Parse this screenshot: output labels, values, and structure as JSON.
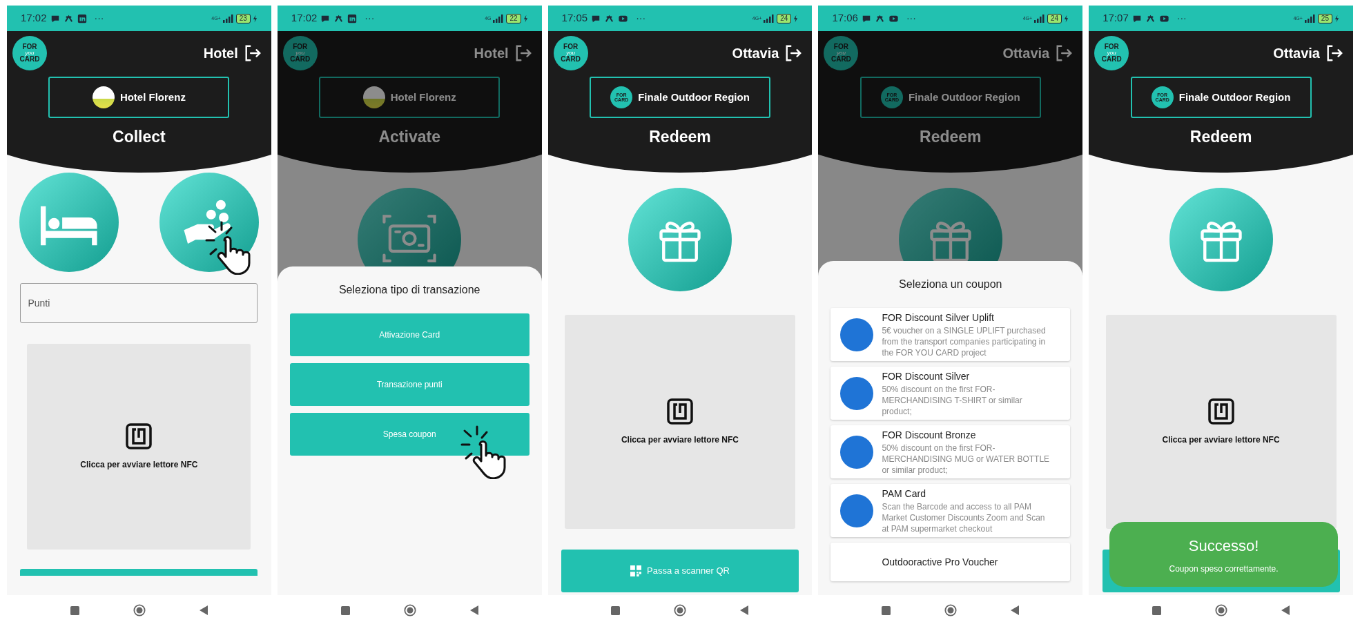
{
  "screens": [
    {
      "status": {
        "time": "17:02",
        "app_icons": [
          {
            "kind": "message"
          },
          {
            "kind": "share"
          },
          {
            "kind": "linkedin"
          }
        ],
        "more": "···",
        "network": "4G+",
        "battery": "23"
      },
      "header": {
        "logo": [
          "FOR",
          "you",
          "CARD"
        ],
        "title": "Hotel",
        "venue": {
          "name": "Hotel Florenz",
          "avatar": {
            "kind": "photo"
          }
        }
      },
      "page_title": "Collect",
      "dimmed": false,
      "hero_icons": [
        {
          "kind": "bed",
          "tapped": false
        },
        {
          "kind": "hand-coins",
          "tapped": true
        }
      ],
      "points_field": {
        "placeholder": "Punti"
      },
      "nfc_panel": {
        "label": "Clicca per avviare lettore NFC"
      },
      "bottom_button": {
        "kind": "cut"
      }
    },
    {
      "status": {
        "time": "17:02",
        "app_icons": [
          {
            "kind": "message"
          },
          {
            "kind": "share"
          },
          {
            "kind": "linkedin"
          }
        ],
        "more": "···",
        "network": "4G",
        "battery": "22"
      },
      "header": {
        "logo": [
          "FOR",
          "you",
          "CARD"
        ],
        "title": "Hotel",
        "venue": {
          "name": "Hotel Florenz",
          "avatar": {
            "kind": "photo"
          }
        }
      },
      "page_title": "Activate",
      "dimmed": true,
      "hero_icons": [
        {
          "kind": "cash-scan",
          "tapped": false
        }
      ],
      "sheet": {
        "kind": "buttons",
        "title": "Seleziona tipo di transazione",
        "buttons": [
          {
            "label": "Attivazione Card",
            "tapped": false
          },
          {
            "label": "Transazione punti",
            "tapped": false
          },
          {
            "label": "Spesa coupon",
            "tapped": true
          }
        ]
      }
    },
    {
      "status": {
        "time": "17:05",
        "app_icons": [
          {
            "kind": "message"
          },
          {
            "kind": "share"
          },
          {
            "kind": "video"
          }
        ],
        "more": "···",
        "network": "4G+",
        "battery": "24"
      },
      "header": {
        "logo": [
          "FOR",
          "you",
          "CARD"
        ],
        "title": "Ottavia",
        "venue": {
          "name": "Finale Outdoor Region",
          "avatar": {
            "kind": "brand",
            "texts": [
              "FOR",
              "CARD"
            ]
          }
        }
      },
      "page_title": "Redeem",
      "dimmed": false,
      "hero_icons": [
        {
          "kind": "gift",
          "tapped": false
        }
      ],
      "nfc_panel": {
        "label": "Clicca per avviare lettore NFC"
      },
      "bottom_button": {
        "kind": "full",
        "label": "Passa a scanner QR"
      }
    },
    {
      "status": {
        "time": "17:06",
        "app_icons": [
          {
            "kind": "message"
          },
          {
            "kind": "share"
          },
          {
            "kind": "video"
          }
        ],
        "more": "···",
        "network": "4G+",
        "battery": "24"
      },
      "header": {
        "logo": [
          "FOR",
          "you",
          "CARD"
        ],
        "title": "Ottavia",
        "venue": {
          "name": "Finale Outdoor Region",
          "avatar": {
            "kind": "brand",
            "texts": [
              "FOR",
              "CARD"
            ]
          }
        }
      },
      "page_title": "Redeem",
      "dimmed": true,
      "hero_icons": [
        {
          "kind": "gift",
          "tapped": false
        }
      ],
      "sheet": {
        "kind": "coupons",
        "title": "Seleziona un coupon",
        "coupons": [
          {
            "title": "FOR Discount Silver Uplift",
            "description": "5€ voucher on a SINGLE UPLIFT purchased from the transport companies participating in the FOR YOU CARD project"
          },
          {
            "title": "FOR Discount Silver",
            "description": "50% discount on the first FOR-MERCHANDISING T-SHIRT or similar product;"
          },
          {
            "title": "FOR Discount Bronze",
            "description": "50% discount on the first FOR-MERCHANDISING MUG or WATER BOTTLE or similar product;"
          },
          {
            "title": "PAM Card",
            "description": "Scan the Barcode and access to all PAM Market Customer Discounts Zoom and Scan at PAM supermarket checkout"
          },
          {
            "title": "Outdooractive Pro Voucher"
          }
        ]
      }
    },
    {
      "status": {
        "time": "17:07",
        "app_icons": [
          {
            "kind": "message"
          },
          {
            "kind": "share"
          },
          {
            "kind": "video"
          }
        ],
        "more": "···",
        "network": "4G+",
        "battery": "25"
      },
      "header": {
        "logo": [
          "FOR",
          "you",
          "CARD"
        ],
        "title": "Ottavia",
        "venue": {
          "name": "Finale Outdoor Region",
          "avatar": {
            "kind": "brand",
            "texts": [
              "FOR",
              "CARD"
            ]
          }
        }
      },
      "page_title": "Redeem",
      "dimmed": false,
      "hero_icons": [
        {
          "kind": "gift",
          "tapped": false
        }
      ],
      "nfc_panel": {
        "label": "Clicca per avviare lettore NFC"
      },
      "bottom_button": {
        "kind": "covered"
      },
      "toast": {
        "title": "Successo!",
        "message": "Coupon speso correttamente."
      }
    }
  ]
}
